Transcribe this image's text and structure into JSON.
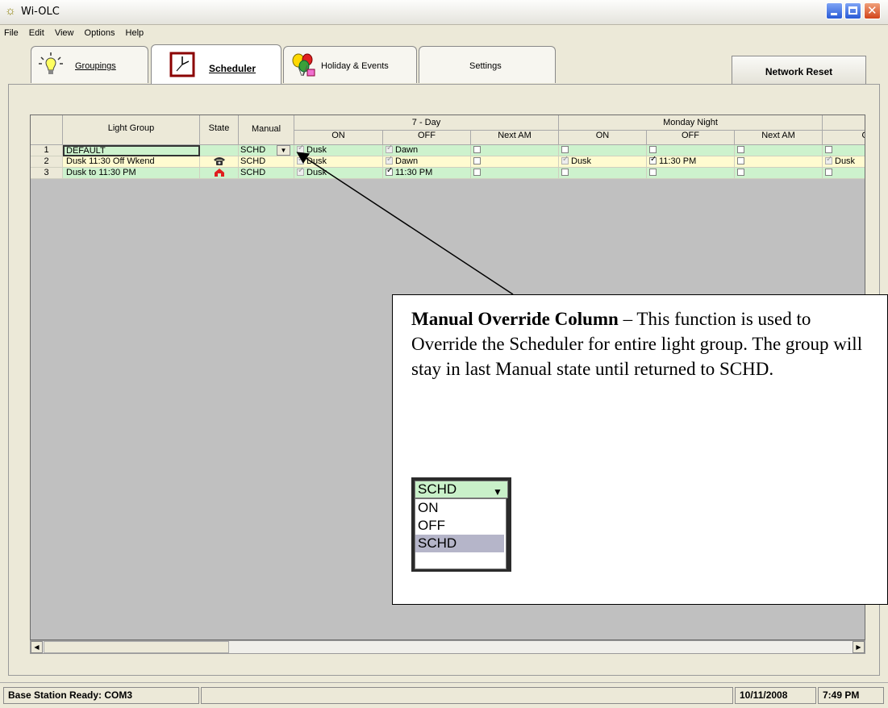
{
  "window": {
    "title": "Wi-OLC"
  },
  "menu": [
    "File",
    "Edit",
    "View",
    "Options",
    "Help"
  ],
  "tabs": [
    {
      "label": "Groupings",
      "icon": "lightbulb-icon"
    },
    {
      "label": "Scheduler",
      "icon": "clock-icon",
      "active": true
    },
    {
      "label": "Holiday & Events",
      "icon": "balloons-icon"
    },
    {
      "label": "Settings"
    }
  ],
  "network_reset_label": "Network Reset",
  "grid": {
    "headers": {
      "light_group": "Light Group",
      "state": "State",
      "manual": "Manual",
      "group1": "7 - Day",
      "group2": "Monday Night",
      "on": "ON",
      "off": "OFF",
      "next_am": "Next AM",
      "partial": "O"
    },
    "rows": [
      {
        "num": "1",
        "name": "DEFAULT",
        "state_icon": "",
        "manual": "SCHD",
        "d7_on": "Dusk",
        "d7_off": "Dawn",
        "d7_next": "",
        "mn_on": "",
        "mn_off": "",
        "mn_next": "",
        "extra": "",
        "color": "#cdf2cd"
      },
      {
        "num": "2",
        "name": "Dusk 11:30 Off Wkend",
        "state_icon": "phone-icon",
        "manual": "SCHD",
        "d7_on": "Dusk",
        "d7_off": "Dawn",
        "d7_next": "",
        "mn_on": "Dusk",
        "mn_off": "11:30 PM",
        "mn_next": "",
        "extra": "Dusk",
        "color": "#fffbd0"
      },
      {
        "num": "3",
        "name": "Dusk to 11:30 PM",
        "state_icon": "house-icon",
        "manual": "SCHD",
        "d7_on": "Dusk",
        "d7_off": "11:30 PM",
        "d7_next": "",
        "mn_on": "",
        "mn_off": "",
        "mn_next": "",
        "extra": "",
        "color": "#cdf2cd"
      }
    ]
  },
  "status": {
    "left": "Base Station Ready: COM3",
    "date": "10/11/2008",
    "time": "7:49 PM"
  },
  "callout": {
    "bold": "Manual Override Column",
    "text": " – This function is used to Override the Scheduler for entire light group. The group will stay in last Manual state until returned to SCHD.",
    "dropdown_selected": "SCHD",
    "dropdown_options": [
      "ON",
      "OFF",
      "SCHD"
    ]
  }
}
